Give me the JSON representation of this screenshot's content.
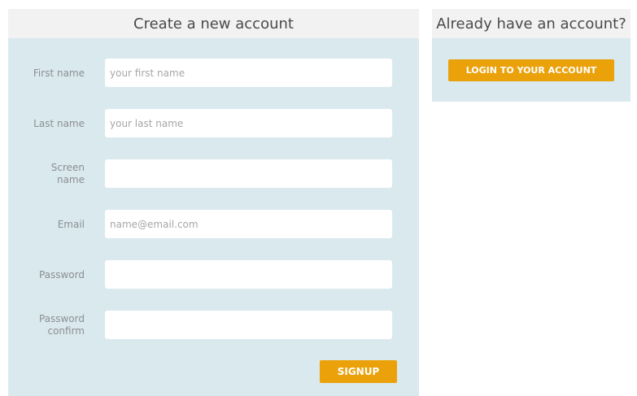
{
  "signup": {
    "title": "Create a new account",
    "fields": [
      {
        "label": "First name",
        "value": "",
        "placeholder": "your first name"
      },
      {
        "label": "Last name",
        "value": "",
        "placeholder": "your last name"
      },
      {
        "label": "Screen name",
        "value": "",
        "placeholder": ""
      },
      {
        "label": "Email",
        "value": "",
        "placeholder": "name@email.com"
      },
      {
        "label": "Password",
        "value": "",
        "placeholder": ""
      },
      {
        "label": "Password confirm",
        "value": "",
        "placeholder": ""
      }
    ],
    "submit_label": "SIGNUP"
  },
  "login": {
    "title": "Already have an account?",
    "button_label": "LOGIN TO YOUR ACCOUNT"
  },
  "colors": {
    "panel_bg": "#dae9ee",
    "header_bg": "#f2f2f2",
    "accent": "#eaa10a"
  }
}
